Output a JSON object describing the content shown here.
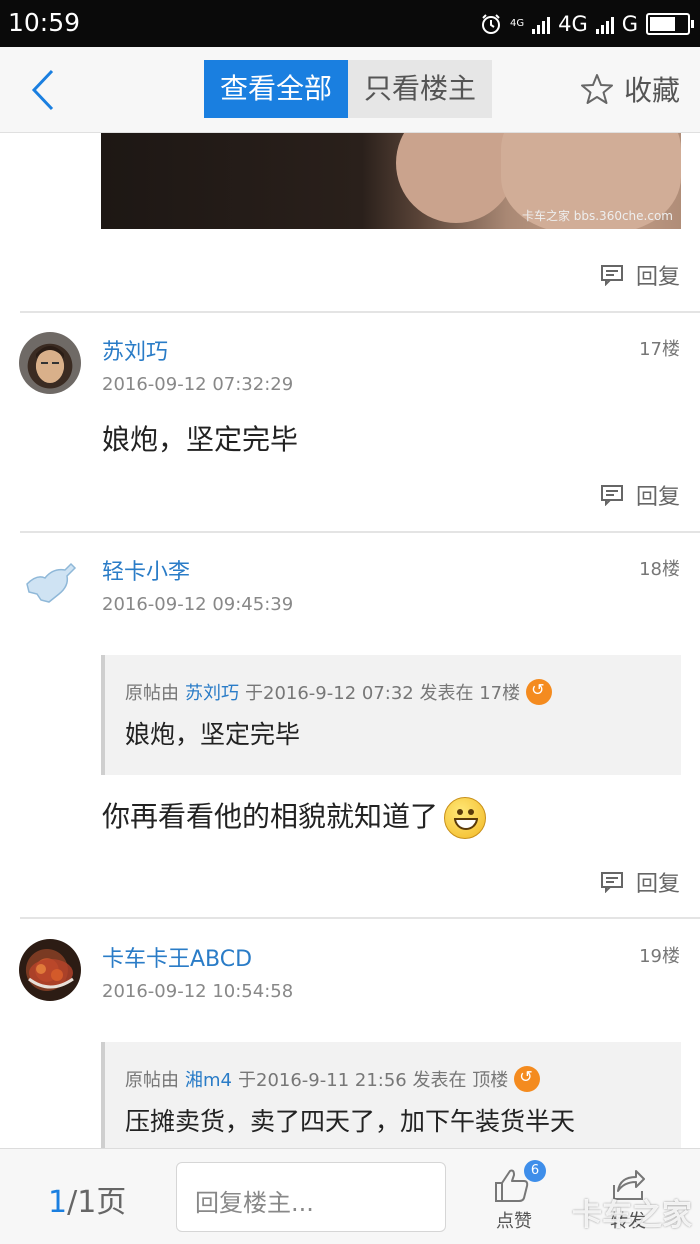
{
  "status_bar": {
    "time": "10:59",
    "net1": "4G",
    "net2": "G",
    "mini_4g": "4G"
  },
  "header": {
    "tab_all": "查看全部",
    "tab_op": "只看楼主",
    "favorite": "收藏"
  },
  "image_watermark": "卡车之家  bbs.360che.com",
  "reply_label": "回复",
  "posts": [
    {
      "username": "苏刘巧",
      "floor": "17楼",
      "time": "2016-09-12 07:32:29",
      "text": "娘炮，坚定完毕"
    },
    {
      "username": "轻卡小李",
      "floor": "18楼",
      "time": "2016-09-12 09:45:39",
      "quote": {
        "prefix": "原帖由",
        "name": "苏刘巧",
        "meta": "于2016-9-12 07:32 发表在 17楼",
        "text": "娘炮，坚定完毕"
      },
      "text": "你再看看他的相貌就知道了"
    },
    {
      "username": "卡车卡王ABCD",
      "floor": "19楼",
      "time": "2016-09-12 10:54:58",
      "quote": {
        "prefix": "原帖由",
        "name": "湘m4",
        "meta": "于2016-9-11 21:56 发表在 顶楼",
        "text": "压摊卖货，卖了四天了，加下午装货半天"
      }
    }
  ],
  "bottom": {
    "page_current": "1",
    "page_total": "/1页",
    "reply_placeholder": "回复楼主...",
    "like_label": "点赞",
    "like_count": "6",
    "share_label": "转发",
    "brand": "卡车之家"
  }
}
